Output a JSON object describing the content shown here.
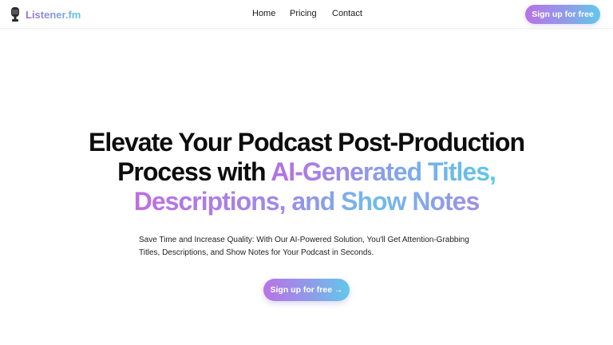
{
  "brand": {
    "name": "Listener.fm",
    "logo_icon": "microphone-icon",
    "gradient_start": "#b66fe0",
    "gradient_mid": "#8e9ce8",
    "gradient_end": "#5ec8ea"
  },
  "nav": {
    "items": [
      {
        "label": "Home"
      },
      {
        "label": "Pricing"
      },
      {
        "label": "Contact"
      }
    ]
  },
  "header": {
    "cta_label": "Sign up for free"
  },
  "hero": {
    "title_line1": "Elevate Your Podcast Post-Production",
    "title_line2_plain": "Process with ",
    "title_line2_grad": "AI-Generated Titles,",
    "title_line3_grad_a": "Descriptions, and Show Notes",
    "subtitle": "Save Time and Increase Quality: With Our AI-Powered Solution, You'll Get Attention-Grabbing Titles, Descriptions, and Show Notes for Your Podcast in Seconds.",
    "cta_label": "Sign up for free →"
  }
}
